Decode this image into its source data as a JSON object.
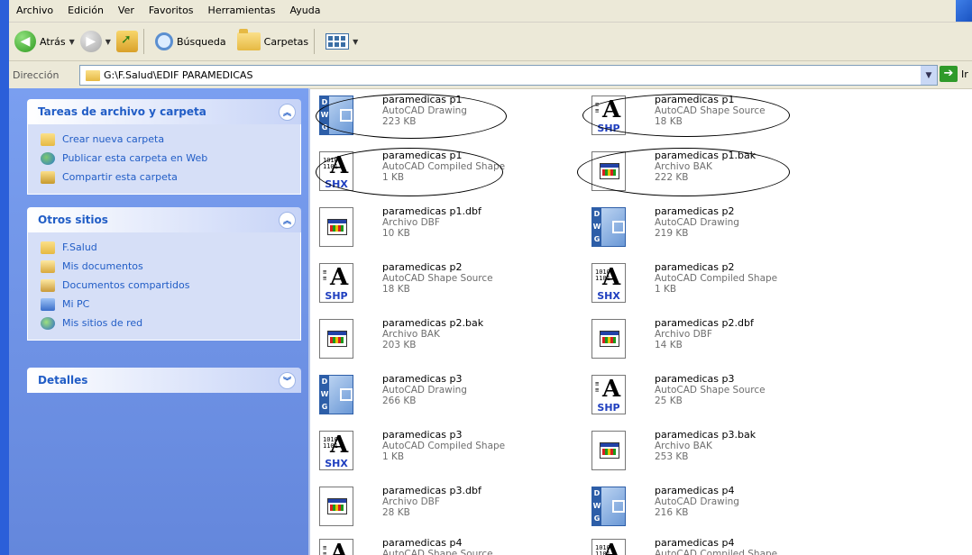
{
  "menu": [
    "Archivo",
    "Edición",
    "Ver",
    "Favoritos",
    "Herramientas",
    "Ayuda"
  ],
  "toolbar": {
    "back_label": "Atrás",
    "search_label": "Búsqueda",
    "folders_label": "Carpetas"
  },
  "address": {
    "label": "Dirección",
    "path": "G:\\F.Salud\\EDIF PARAMEDICAS",
    "go_label": "Ir"
  },
  "panels": {
    "tasks": {
      "title": "Tareas de archivo y carpeta",
      "items": [
        "Crear nueva carpeta",
        "Publicar esta carpeta en Web",
        "Compartir esta carpeta"
      ]
    },
    "other": {
      "title": "Otros sitios",
      "items": [
        "F.Salud",
        "Mis documentos",
        "Documentos compartidos",
        "Mi PC",
        "Mis sitios de red"
      ]
    },
    "details": {
      "title": "Detalles"
    }
  },
  "files": [
    {
      "name": "paramedicas p1",
      "type": "AutoCAD Drawing",
      "size": "223 KB",
      "icon": "dwg-icon"
    },
    {
      "name": "paramedicas p1",
      "type": "AutoCAD Shape Source",
      "size": "18 KB",
      "icon": "shp-icon"
    },
    {
      "name": "paramedicas p1",
      "type": "AutoCAD Compiled Shape",
      "size": "1 KB",
      "icon": "shx-icon"
    },
    {
      "name": "paramedicas p1.bak",
      "type": "Archivo BAK",
      "size": "222 KB",
      "icon": "bak-icon"
    },
    {
      "name": "paramedicas p1.dbf",
      "type": "Archivo DBF",
      "size": "10 KB",
      "icon": "dbf-icon"
    },
    {
      "name": "paramedicas p2",
      "type": "AutoCAD Drawing",
      "size": "219 KB",
      "icon": "dwg-icon"
    },
    {
      "name": "paramedicas p2",
      "type": "AutoCAD Shape Source",
      "size": "18 KB",
      "icon": "shp-icon"
    },
    {
      "name": "paramedicas p2",
      "type": "AutoCAD Compiled Shape",
      "size": "1 KB",
      "icon": "shx-icon"
    },
    {
      "name": "paramedicas p2.bak",
      "type": "Archivo BAK",
      "size": "203 KB",
      "icon": "bak-icon"
    },
    {
      "name": "paramedicas p2.dbf",
      "type": "Archivo DBF",
      "size": "14 KB",
      "icon": "dbf-icon"
    },
    {
      "name": "paramedicas p3",
      "type": "AutoCAD Drawing",
      "size": "266 KB",
      "icon": "dwg-icon"
    },
    {
      "name": "paramedicas p3",
      "type": "AutoCAD Shape Source",
      "size": "25 KB",
      "icon": "shp-icon"
    },
    {
      "name": "paramedicas p3",
      "type": "AutoCAD Compiled Shape",
      "size": "1 KB",
      "icon": "shx-icon"
    },
    {
      "name": "paramedicas p3.bak",
      "type": "Archivo BAK",
      "size": "253 KB",
      "icon": "bak-icon"
    },
    {
      "name": "paramedicas p3.dbf",
      "type": "Archivo DBF",
      "size": "28 KB",
      "icon": "dbf-icon"
    },
    {
      "name": "paramedicas p4",
      "type": "AutoCAD Drawing",
      "size": "216 KB",
      "icon": "dwg-icon"
    },
    {
      "name": "paramedicas p4",
      "type": "AutoCAD Shape Source",
      "size": "",
      "icon": "shp-icon"
    },
    {
      "name": "paramedicas p4",
      "type": "AutoCAD Compiled Shape",
      "size": "",
      "icon": "shx-icon"
    }
  ]
}
